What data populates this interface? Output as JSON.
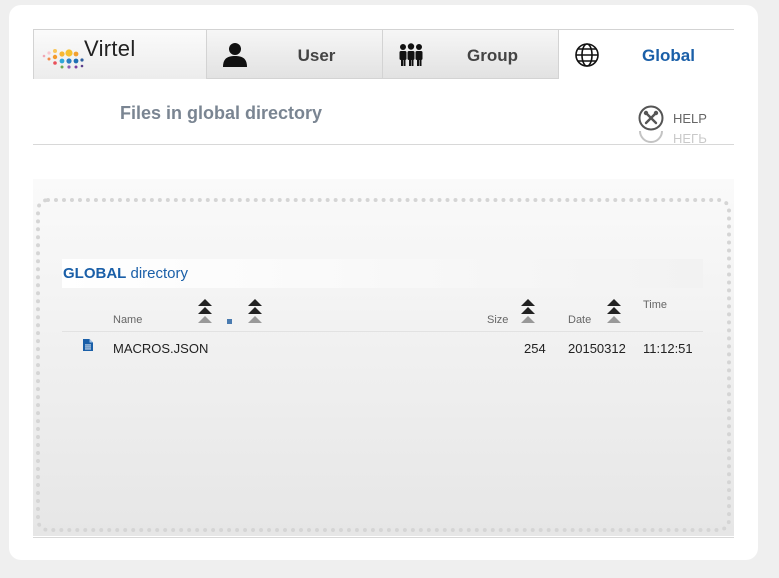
{
  "app": {
    "logo_text": "Virtel"
  },
  "tabs": [
    {
      "label": "User",
      "icon": "user-icon",
      "active": false
    },
    {
      "label": "Group",
      "icon": "group-icon",
      "active": false
    },
    {
      "label": "Global",
      "icon": "globe-icon",
      "active": true
    }
  ],
  "page": {
    "title": "Files in global directory",
    "help_label": "HELP"
  },
  "directory": {
    "title_bold": "GLOBAL",
    "title_rest": " directory",
    "columns": {
      "name": "Name",
      "size": "Size",
      "date": "Date",
      "time": "Time"
    },
    "rows": [
      {
        "icon": "file-icon",
        "name": "MACROS.JSON",
        "size": "254",
        "date": "20150312",
        "time": "11:12:51"
      }
    ]
  },
  "colors": {
    "accent": "#1a5fa8",
    "title_gray": "#7a8592",
    "text": "#222222"
  }
}
